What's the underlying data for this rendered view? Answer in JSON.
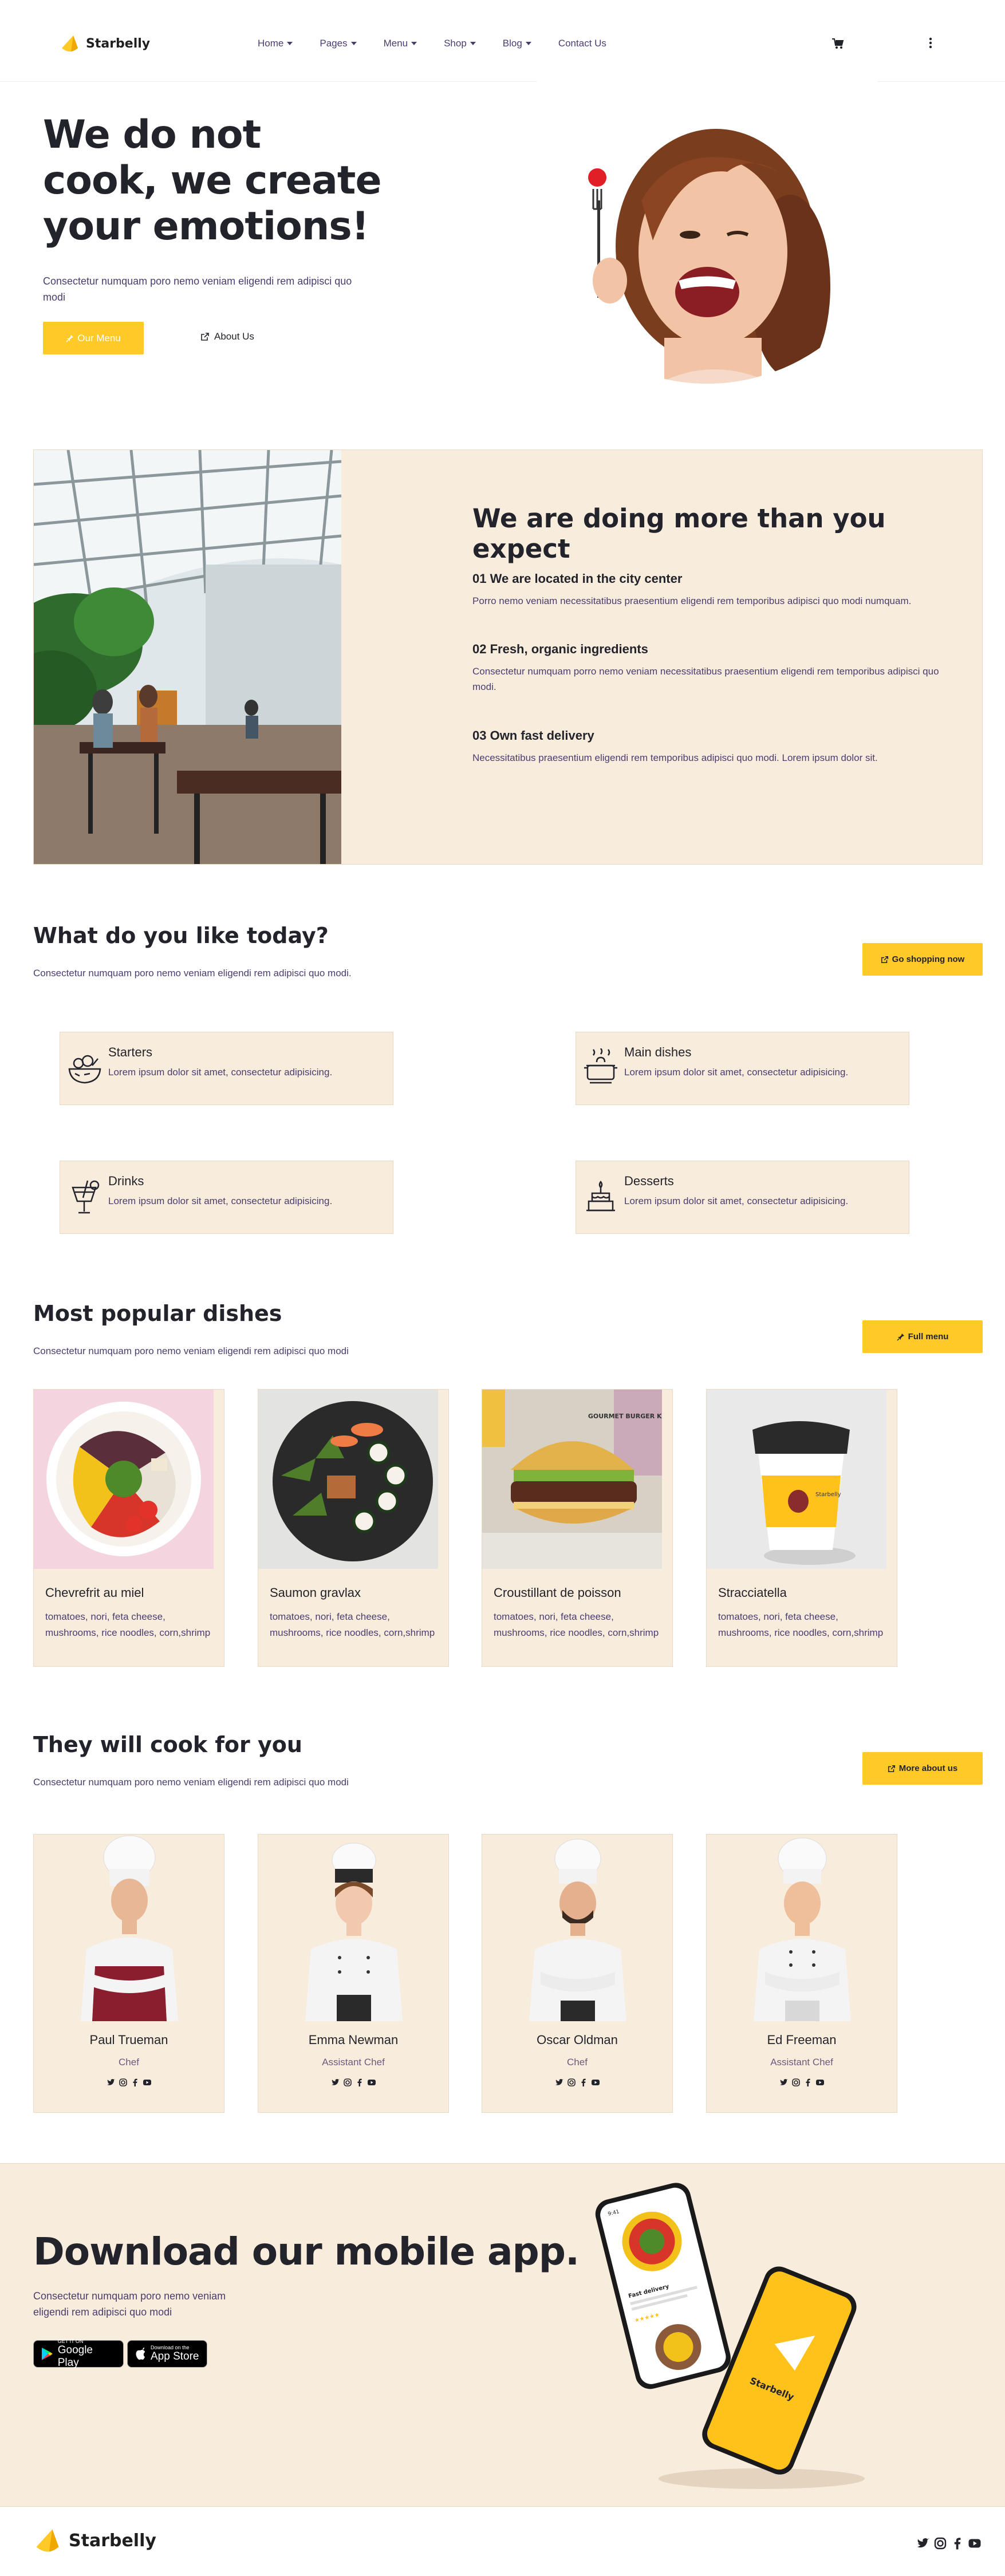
{
  "brand": {
    "name": "Starbelly",
    "accent": "#ffc928",
    "cream": "#f8ecdd",
    "text_dark": "#23232b",
    "text_muted": "#4a3d6d"
  },
  "nav": {
    "items": [
      {
        "label": "Home",
        "dropdown": true
      },
      {
        "label": "Pages",
        "dropdown": true
      },
      {
        "label": "Menu",
        "dropdown": true
      },
      {
        "label": "Shop",
        "dropdown": true
      },
      {
        "label": "Blog",
        "dropdown": true
      },
      {
        "label": "Contact Us",
        "dropdown": false
      }
    ],
    "cart_icon": "cart-icon",
    "more_icon": "more-vertical-icon"
  },
  "hero": {
    "title": "We do not cook, we create your emotions!",
    "text": "Consectetur numquam poro nemo veniam eligendi rem adipisci quo modi",
    "primary_button": "Our Menu",
    "secondary_button": "About Us"
  },
  "about": {
    "title": "We are doing more than you expect",
    "items": [
      {
        "title": "01 We are located in the city center",
        "text": "Porro nemo veniam necessitatibus praesentium eligendi rem temporibus adipisci quo modi numquam."
      },
      {
        "title": "02 Fresh, organic ingredients",
        "text": "Consectetur numquam porro nemo veniam necessitatibus praesentium eligendi rem temporibus adipisci quo modi."
      },
      {
        "title": "03 Own fast delivery",
        "text": "Necessitatibus praesentium eligendi rem temporibus adipisci quo modi. Lorem ipsum dolor sit."
      }
    ]
  },
  "categories": {
    "title": "What do you like today?",
    "text": "Consectetur numquam poro nemo veniam eligendi rem adipisci quo modi.",
    "button": "Go shopping now",
    "items": [
      {
        "title": "Starters",
        "text": "Lorem ipsum dolor sit amet, consectetur adipisicing.",
        "icon": "salad-bowl-icon"
      },
      {
        "title": "Main dishes",
        "text": "Lorem ipsum dolor sit amet, consectetur adipisicing.",
        "icon": "cooking-pot-icon"
      },
      {
        "title": "Drinks",
        "text": "Lorem ipsum dolor sit amet, consectetur adipisicing.",
        "icon": "cocktail-icon"
      },
      {
        "title": "Desserts",
        "text": "Lorem ipsum dolor sit amet, consectetur adipisicing.",
        "icon": "cake-icon"
      }
    ]
  },
  "popular": {
    "title": "Most popular dishes",
    "text": "Consectetur numquam poro nemo veniam eligendi rem adipisci quo modi",
    "button": "Full menu",
    "items": [
      {
        "title": "Chevrefrit au miel",
        "text": "tomatoes, nori, feta cheese, mushrooms, rice noodles, corn,shrimp"
      },
      {
        "title": "Saumon gravlax",
        "text": "tomatoes, nori, feta cheese, mushrooms, rice noodles, corn,shrimp"
      },
      {
        "title": "Croustillant de poisson",
        "text": "tomatoes, nori, feta cheese, mushrooms, rice noodles, corn,shrimp"
      },
      {
        "title": "Stracciatella",
        "text": "tomatoes, nori, feta cheese, mushrooms, rice noodles, corn,shrimp"
      }
    ],
    "burger_sign": "GOURMET BURGER KITCHEN",
    "cup_label": "Starbelly"
  },
  "team": {
    "title": "They will cook for you",
    "text": "Consectetur numquam poro nemo veniam eligendi rem adipisci quo modi",
    "button": "More about us",
    "members": [
      {
        "name": "Paul Trueman",
        "role": "Chef"
      },
      {
        "name": "Emma Newman",
        "role": "Assistant Chef"
      },
      {
        "name": "Oscar Oldman",
        "role": "Chef"
      },
      {
        "name": "Ed Freeman",
        "role": "Assistant Chef"
      }
    ]
  },
  "app": {
    "title": "Download our mobile app.",
    "text": "Consectetur numquam poro nemo veniam eligendi rem adipisci quo modi",
    "google_top": "GET IT ON",
    "google_name": "Google Play",
    "apple_top": "Download on the",
    "apple_name": "App Store",
    "phone_time": "9:41",
    "phone_section": "Fast delivery",
    "phone_brand": "Starbelly"
  },
  "footer": {
    "brand": "Starbelly"
  }
}
